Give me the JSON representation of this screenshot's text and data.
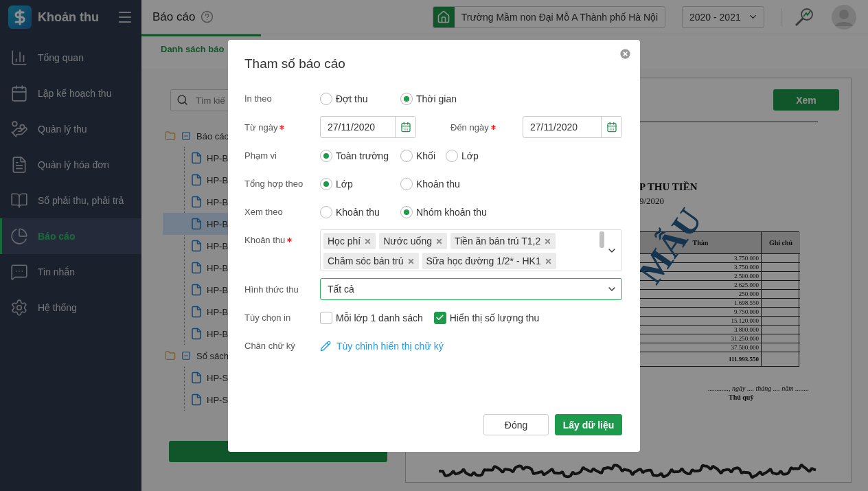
{
  "sidebar": {
    "app_title": "Khoản thu",
    "items": [
      {
        "label": "Tổng quan",
        "selected": false
      },
      {
        "label": "Lập kế hoạch thu",
        "selected": false
      },
      {
        "label": "Quản lý thu",
        "selected": false
      },
      {
        "label": "Quản lý hóa đơn",
        "selected": false
      },
      {
        "label": "Sổ phải thu, phải trả",
        "selected": false
      },
      {
        "label": "Báo cáo",
        "selected": true
      },
      {
        "label": "Tin nhắn",
        "selected": false
      },
      {
        "label": "Hệ thống",
        "selected": false
      }
    ]
  },
  "header": {
    "title": "Báo cáo",
    "school": "Trường Mầm non Đại Mỗ A Thành phố Hà Nội",
    "year": "2020 - 2021"
  },
  "tabs": [
    {
      "label": "Danh sách báo",
      "selected": true
    }
  ],
  "report_list": {
    "search_placeholder": "Tìm kiế",
    "tree": [
      {
        "label": "Báo cáo",
        "expanded": true,
        "children": [
          {
            "label": "HP-B",
            "selected": false
          },
          {
            "label": "HP-B",
            "selected": false
          },
          {
            "label": "HP-B",
            "selected": false
          },
          {
            "label": "HP-B",
            "selected": true
          },
          {
            "label": "HP-B",
            "selected": false
          },
          {
            "label": "HP-B",
            "selected": false
          },
          {
            "label": "HP-B",
            "selected": false
          },
          {
            "label": "HP-B",
            "selected": false
          },
          {
            "label": "HP-B",
            "selected": false
          }
        ]
      },
      {
        "label": "Sổ sách",
        "expanded": true,
        "children": [
          {
            "label": "HP-S",
            "selected": false
          },
          {
            "label": "HP-S",
            "selected": false
          }
        ]
      }
    ]
  },
  "preview": {
    "view_button": "Xem",
    "title": "P THU TIỀN",
    "subtitle": "9/2020",
    "stamp": "MẪU",
    "columns": [
      "Thàn",
      "Ghi chú"
    ],
    "amounts": [
      "3.750.000",
      "3.750.000",
      "2.500.000",
      "2.625.000",
      "250.000",
      "1.698.550",
      "9.750.000",
      "15.120.000",
      "3.800.000",
      "31.250.000",
      "37.500.000"
    ],
    "total": "111.993.550",
    "date_line": "............, ngày .... tháng .... năm ........",
    "signer": "Thủ quỹ"
  },
  "dialog": {
    "title": "Tham số báo cáo",
    "fields": [
      {
        "kind": "radio",
        "label": "In theo",
        "options": [
          {
            "label": "Đợt thu",
            "selected": false
          },
          {
            "label": "Thời gian",
            "selected": true
          }
        ]
      },
      {
        "kind": "date_range",
        "label": "Từ ngày",
        "required": true,
        "value": "27/11/2020",
        "end_label": "Đến ngày",
        "end_required": true,
        "end_value": "27/11/2020"
      },
      {
        "kind": "radio",
        "label": "Phạm vi",
        "options": [
          {
            "label": "Toàn trường",
            "selected": true
          },
          {
            "label": "Khối",
            "selected": false
          },
          {
            "label": "Lớp",
            "selected": false
          }
        ]
      },
      {
        "kind": "radio",
        "label": "Tổng hợp theo",
        "options": [
          {
            "label": "Lớp",
            "selected": true
          },
          {
            "label": "Khoản thu",
            "selected": false
          }
        ]
      },
      {
        "kind": "radio",
        "label": "Xem theo",
        "options": [
          {
            "label": "Khoản thu",
            "selected": false
          },
          {
            "label": "Nhóm khoản thu",
            "selected": true
          }
        ]
      },
      {
        "kind": "tags",
        "label": "Khoản thu",
        "required": true,
        "tags": [
          "Học phí",
          "Nước uống",
          "Tiền ăn bán trú T1,2",
          "Chăm sóc bán trú",
          "Sữa học đường 1/2* - HK1"
        ]
      },
      {
        "kind": "select",
        "label": "Hình thức thu",
        "value": "Tất cả"
      },
      {
        "kind": "checkbox",
        "label": "Tùy chọn in",
        "options": [
          {
            "label": "Mỗi lớp 1 danh sách",
            "checked": false
          },
          {
            "label": "Hiển thị số lượng thu",
            "checked": true
          }
        ]
      },
      {
        "kind": "link",
        "label": "Chân chữ ký",
        "text": "Tùy chỉnh hiển thị chữ ký"
      }
    ],
    "buttons": [
      {
        "label": "Đóng",
        "kind": "secondary"
      },
      {
        "label": "Lấy dữ liệu",
        "kind": "primary"
      }
    ]
  }
}
